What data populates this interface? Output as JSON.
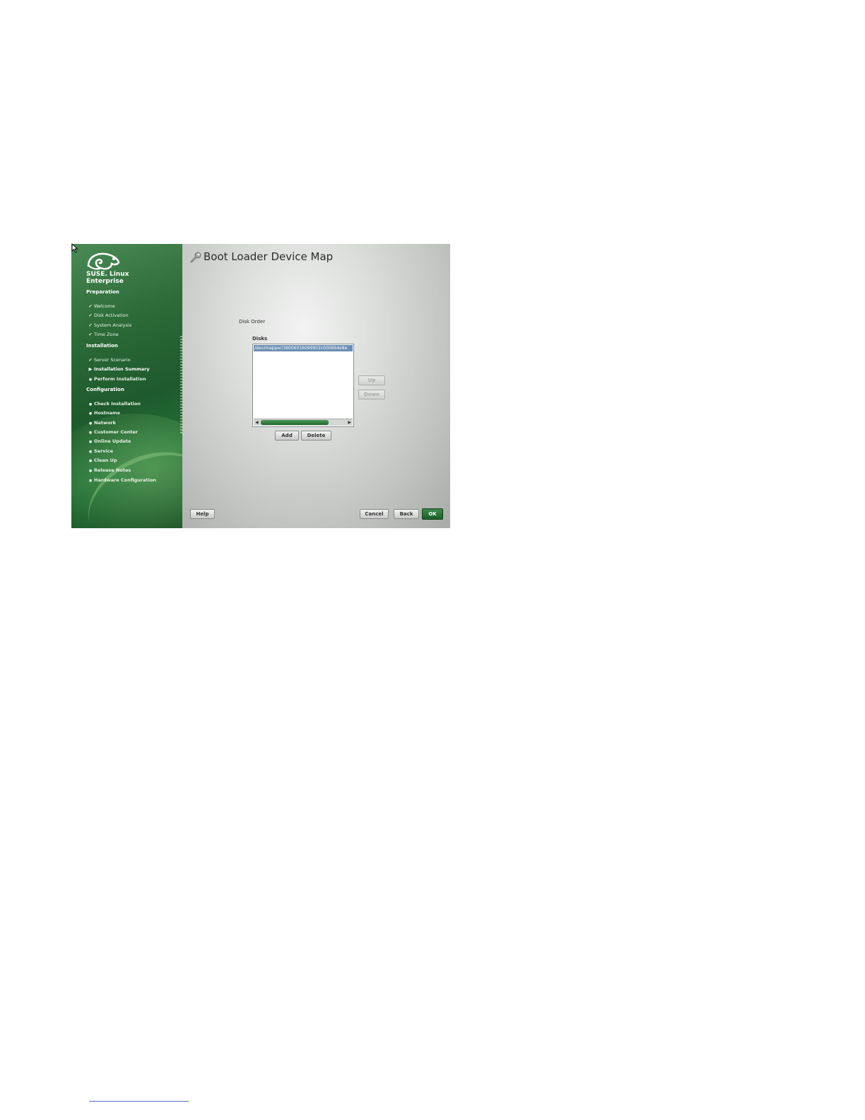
{
  "brand": {
    "line1": "SUSE",
    "line2": "Linux",
    "line3": "Enterprise",
    "mark": "."
  },
  "sidebar": {
    "sections": [
      {
        "title": "Preparation"
      },
      {
        "title": "Installation"
      },
      {
        "title": "Configuration"
      }
    ],
    "preparation": [
      {
        "label": "Welcome",
        "state": "done"
      },
      {
        "label": "Disk Activation",
        "state": "done"
      },
      {
        "label": "System Analysis",
        "state": "done"
      },
      {
        "label": "Time Zone",
        "state": "done"
      }
    ],
    "installation": [
      {
        "label": "Server Scenario",
        "state": "done"
      },
      {
        "label": "Installation Summary",
        "state": "current"
      },
      {
        "label": "Perform Installation",
        "state": "todo"
      }
    ],
    "configuration": [
      {
        "label": "Check Installation",
        "state": "todo"
      },
      {
        "label": "Hostname",
        "state": "todo"
      },
      {
        "label": "Network",
        "state": "todo"
      },
      {
        "label": "Customer Center",
        "state": "todo"
      },
      {
        "label": "Online Update",
        "state": "todo"
      },
      {
        "label": "Service",
        "state": "todo"
      },
      {
        "label": "Clean Up",
        "state": "todo"
      },
      {
        "label": "Release Notes",
        "state": "todo"
      },
      {
        "label": "Hardware Configuration",
        "state": "todo"
      }
    ]
  },
  "main": {
    "title": "Boot Loader Device Map",
    "disk_order_label": "Disk Order",
    "disks_label": "Disks",
    "disks": [
      "/dev/mapper/36006016099902c000664e8e"
    ],
    "buttons": {
      "up": "Up",
      "down": "Down",
      "add": "Add",
      "delete": "Delete"
    }
  },
  "footer": {
    "help": "Help",
    "cancel": "Cancel",
    "back": "Back",
    "ok": "OK"
  },
  "colors": {
    "sidebar_green": "#2c6a38",
    "selection": "#6b8fb5",
    "ok_button": "#1b5e2a"
  },
  "icons": {
    "title": "wrench-icon",
    "check": "checkmark-icon",
    "current": "triangle-right-icon",
    "todo": "bullet-icon"
  }
}
